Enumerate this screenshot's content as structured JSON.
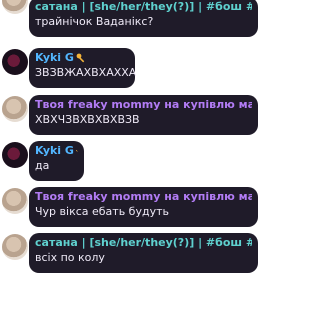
{
  "messages": [
    {
      "author": "сатана | [she/her/they(?)] | #бош #урако...",
      "text": "трайнічок Ваданікс?",
      "name_color": "teal"
    },
    {
      "author": "Kyki G",
      "text": "ЗВЗВЖАХВХАХХА",
      "name_color": "blue",
      "badge": "key-icon"
    },
    {
      "author": "Твоя freaky mommy на купівлю мармел...",
      "text": "ХВХЧЗВХВХВХВЗВ",
      "name_color": "purple"
    },
    {
      "author": "Kyki G",
      "text": "да",
      "name_color": "blue",
      "badge": "key-icon"
    },
    {
      "author": "Твоя freaky mommy на купівлю мармел...",
      "text": "Чур вікса ебать будуть",
      "name_color": "purple"
    },
    {
      "author": "сатана | [she/her/they(?)] | #бош #урако...",
      "text": "всіх по колу",
      "name_color": "teal"
    }
  ],
  "colors": {
    "bubble": "#1f1b29",
    "teal": "#5fd1cf",
    "purple": "#b27cf5",
    "blue": "#52b6ff",
    "badge": "#f3b43a"
  }
}
